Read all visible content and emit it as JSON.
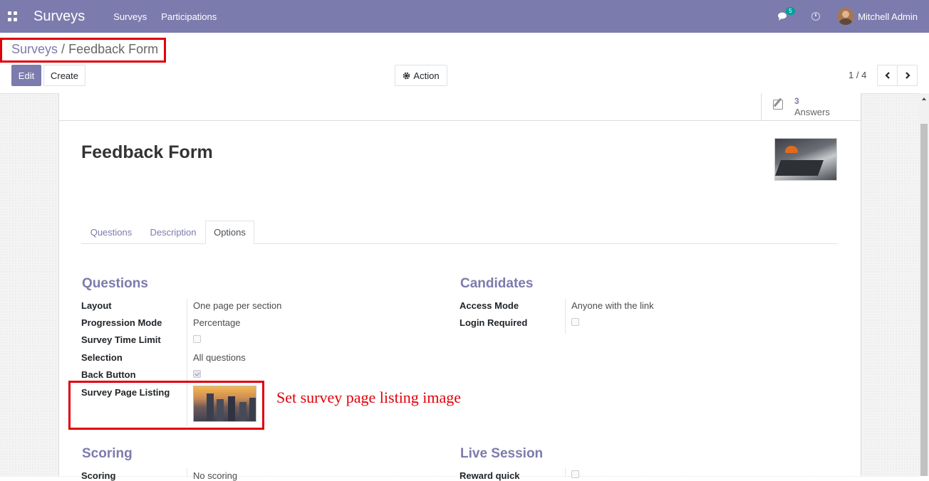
{
  "navbar": {
    "app_name": "Surveys",
    "menu": [
      "Surveys",
      "Participations"
    ],
    "chat_count": "5",
    "user_name": "Mitchell Admin"
  },
  "breadcrumb": {
    "parent": "Surveys",
    "separator": "/",
    "current": "Feedback Form"
  },
  "control_panel": {
    "edit_label": "Edit",
    "create_label": "Create",
    "action_label": "Action",
    "pager": "1 / 4"
  },
  "stat_button": {
    "value": "3",
    "label": "Answers"
  },
  "form": {
    "title": "Feedback Form",
    "tabs": [
      {
        "label": "Questions",
        "active": false
      },
      {
        "label": "Description",
        "active": false
      },
      {
        "label": "Options",
        "active": true
      }
    ],
    "questions": {
      "title": "Questions",
      "layout_label": "Layout",
      "layout_value": "One page per section",
      "progression_label": "Progression Mode",
      "progression_value": "Percentage",
      "time_limit_label": "Survey Time Limit",
      "time_limit_checked": false,
      "selection_label": "Selection",
      "selection_value": "All questions",
      "back_button_label": "Back Button",
      "back_button_checked": true,
      "page_listing_label": "Survey Page Listing"
    },
    "candidates": {
      "title": "Candidates",
      "access_mode_label": "Access Mode",
      "access_mode_value": "Anyone with the link",
      "login_required_label": "Login Required",
      "login_required_checked": false
    },
    "scoring": {
      "title": "Scoring",
      "scoring_label": "Scoring",
      "scoring_value": "No scoring"
    },
    "live_session": {
      "title": "Live Session",
      "reward_label": "Reward quick"
    }
  },
  "annotation": "Set survey page listing image",
  "colors": {
    "brand": "#7c7bad",
    "highlight": "#e0000b"
  }
}
